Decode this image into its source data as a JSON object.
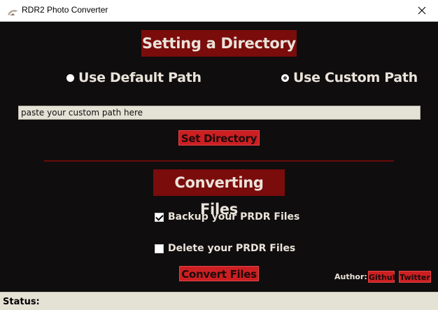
{
  "window": {
    "title": "RDR2 Photo Converter",
    "icon": "rdr2-app-icon",
    "close_icon": "close-icon"
  },
  "directory_section": {
    "title": "Setting a Directory",
    "radio_default": {
      "label": "Use Default Path",
      "selected": false
    },
    "radio_custom": {
      "label": "Use Custom Path",
      "selected": true
    },
    "path_input": {
      "placeholder": "paste your custom path here",
      "value": ""
    },
    "set_button": "Set Directory"
  },
  "convert_section": {
    "title": "Converting Files",
    "backup_checkbox": {
      "label": "Backup your PRDR Files",
      "checked": true
    },
    "delete_checkbox": {
      "label": "Delete your PRDR Files",
      "checked": false
    },
    "convert_button": "Convert Files"
  },
  "author": {
    "label": "Author:",
    "github": "Github",
    "twitter": "Twitter"
  },
  "status": {
    "label": "Status:",
    "value": ""
  },
  "colors": {
    "background": "#0f0d0e",
    "title_bg": "#7a0c0c",
    "button_bg": "#cc1f22",
    "text": "#eae3da",
    "input_bg": "#e4e2d5"
  }
}
